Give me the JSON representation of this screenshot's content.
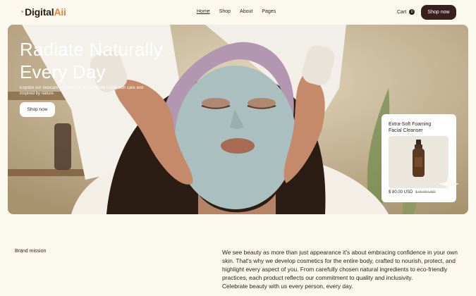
{
  "nav": {
    "logo_main": "Digital",
    "logo_accent": "Aii",
    "links": [
      "Home",
      "Shop",
      "About",
      "Pages"
    ],
    "cart_label": "Cart",
    "cart_count": "0",
    "cta_label": "Shop now"
  },
  "hero": {
    "title": "Radiate Naturally Every Day",
    "subtitle": "Explore our skincare must-haves, thoughtfully made with care and inspired by nature.",
    "button_label": "Shop now"
  },
  "product": {
    "name": "Extra-Soft Foaming Facial Cleanser",
    "price": "$ 80.00 USD",
    "old_price": "$ 99.00 USD"
  },
  "mission": {
    "label": "Brand mission",
    "text": "We see beauty as more than just appearance it's about embracing confidence in your own skin. That's why we develop cosmetics for the entire body, crafted to nourish, protect, and highlight every aspect of you. From carefully chosen natural ingredients to eco-friendly practices, each product reflects our commitment to quality and inclusivity.",
    "text2": "Celebrate beauty with us every person, every day."
  },
  "colors": {
    "background": "#fbf8ee",
    "brand_dark": "#3a1f1f",
    "logo_accent": "#e8833a"
  }
}
